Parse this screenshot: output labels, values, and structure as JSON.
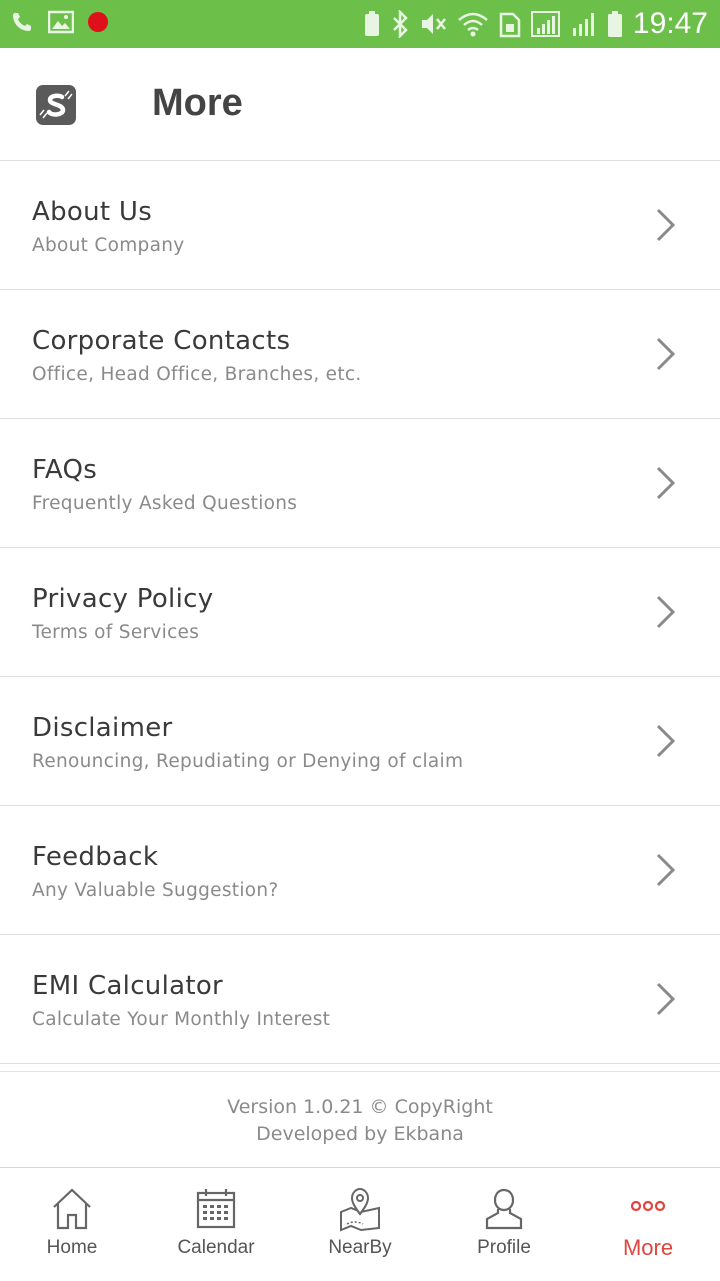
{
  "status_bar": {
    "time": "19:47",
    "icons": [
      "phone-icon",
      "image-icon",
      "record-icon",
      "battery-saver-icon",
      "bluetooth-icon",
      "mute-icon",
      "wifi-icon",
      "sim-icon",
      "signal-icon",
      "signal-icon-2",
      "battery-icon"
    ],
    "background": "#6cc04a"
  },
  "header": {
    "title": "More",
    "logo_icon": "app-logo-icon"
  },
  "menu": {
    "items": [
      {
        "title": "About Us",
        "subtitle": "About Company"
      },
      {
        "title": "Corporate Contacts",
        "subtitle": "Office, Head Office, Branches, etc."
      },
      {
        "title": "FAQs",
        "subtitle": "Frequently Asked Questions"
      },
      {
        "title": "Privacy Policy",
        "subtitle": "Terms of Services"
      },
      {
        "title": "Disclaimer",
        "subtitle": "Renouncing, Repudiating or Denying of claim"
      },
      {
        "title": "Feedback",
        "subtitle": "Any Valuable Suggestion?"
      },
      {
        "title": "EMI Calculator",
        "subtitle": "Calculate Your Monthly Interest"
      }
    ]
  },
  "footer": {
    "version": "Version 1.0.21 © CopyRight",
    "developer": "Developed by Ekbana"
  },
  "bottom_nav": {
    "items": [
      {
        "label": "Home",
        "icon": "home-icon"
      },
      {
        "label": "Calendar",
        "icon": "calendar-icon"
      },
      {
        "label": "NearBy",
        "icon": "map-pin-icon"
      },
      {
        "label": "Profile",
        "icon": "profile-icon"
      },
      {
        "label": "More",
        "icon": "more-dots-icon"
      }
    ],
    "active": "More",
    "active_color": "#e0453d"
  }
}
